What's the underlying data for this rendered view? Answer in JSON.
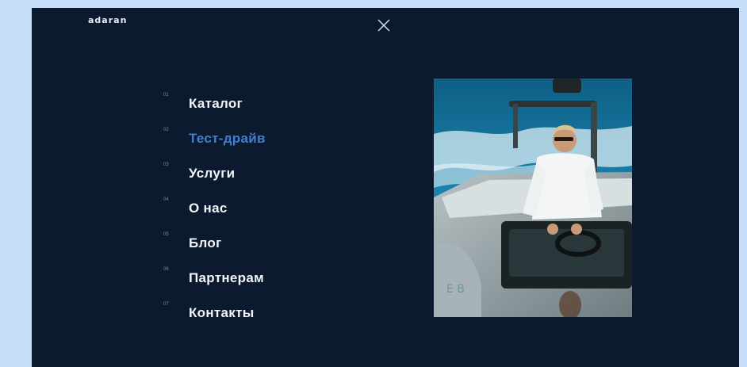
{
  "brand": {
    "logo_text": "adaran"
  },
  "close": {
    "icon": "close-icon"
  },
  "menu": {
    "active_color": "#3f7fd6",
    "items": [
      {
        "num": "01",
        "label": "Каталог",
        "active": false
      },
      {
        "num": "02",
        "label": "Тест-драйв",
        "active": true
      },
      {
        "num": "03",
        "label": "Услуги",
        "active": false
      },
      {
        "num": "04",
        "label": "О нас",
        "active": false
      },
      {
        "num": "05",
        "label": "Блог",
        "active": false
      },
      {
        "num": "06",
        "label": "Партнерам",
        "active": false
      },
      {
        "num": "07",
        "label": "Контакты",
        "active": false
      }
    ]
  },
  "photo": {
    "subject": "man-steering-motor-boat"
  }
}
